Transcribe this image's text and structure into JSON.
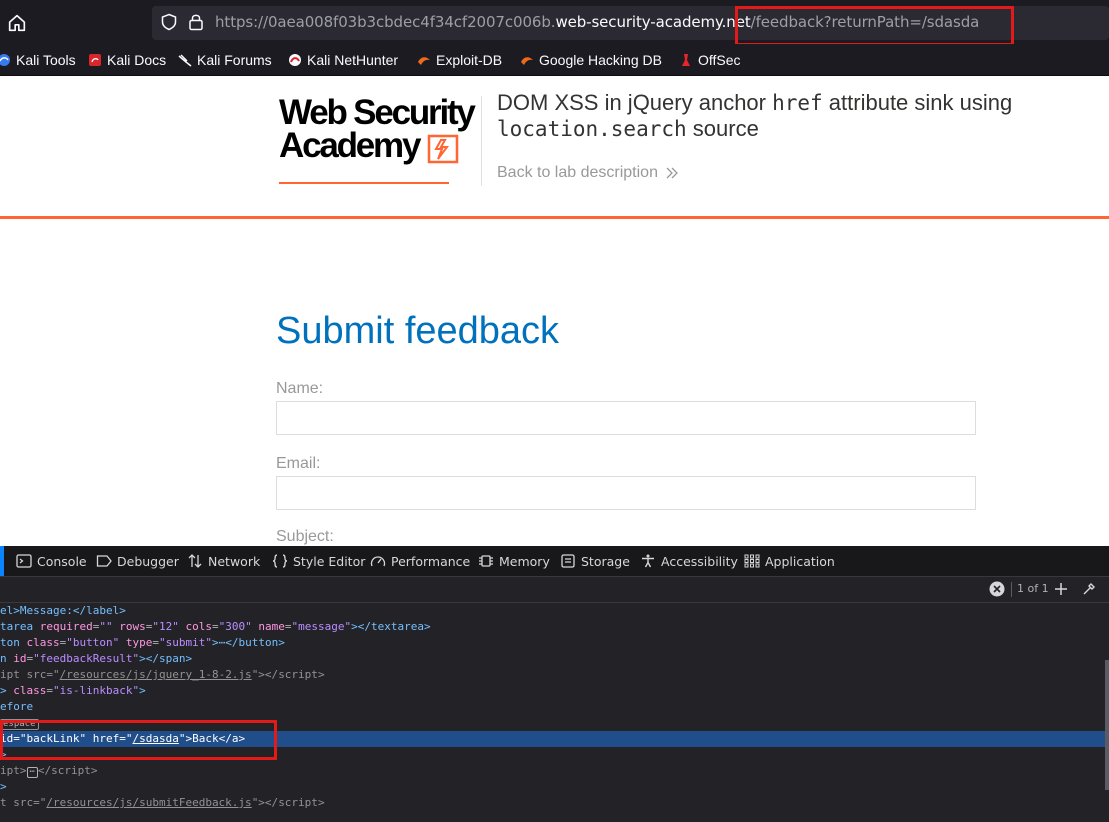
{
  "browser": {
    "url_prefix": "https://0aea008f03b3cbdec4f34cf2007c006b.",
    "url_host": "web-security-academy.net",
    "url_path": "/feedback?returnPath=/sdasda",
    "bookmarks": [
      "Kali Tools",
      "Kali Docs",
      "Kali Forums",
      "Kali NetHunter",
      "Exploit-DB",
      "Google Hacking DB",
      "OffSec"
    ]
  },
  "header": {
    "logo_line1": "Web Security",
    "logo_line2": "Academy",
    "lab_title_a": "DOM XSS in jQuery anchor ",
    "lab_title_code1": "href",
    "lab_title_b": " attribute sink using",
    "lab_title_code2": "location.search",
    "lab_title_c": " source",
    "back_link": "Back to lab description"
  },
  "form": {
    "title": "Submit feedback",
    "name_label": "Name:",
    "email_label": "Email:",
    "subject_label": "Subject:"
  },
  "devtools": {
    "tabs": [
      "Console",
      "Debugger",
      "Network",
      "Style Editor",
      "Performance",
      "Memory",
      "Storage",
      "Accessibility",
      "Application"
    ],
    "search_count": "1 of 1",
    "lines": {
      "l1_frag": "el",
      "l1_gt": ">Message:</",
      "l1_tag": "label",
      "l2_frag": "tarea",
      "l3_frag": "ton",
      "l3_tail": ">⋯</",
      "l3_close": "button",
      "l4_frag": "n",
      "l5_frag": "ipt",
      "l5_src": "/resources/js/jquery_1-8-2.js",
      "l6_class": "is-linkback",
      "l7_pseudo": "efore",
      "l8_pill": "espace",
      "l9_id": "backLink",
      "l9_href": "/sdasda",
      "l9_text": "Back",
      "l11_frag": "ipt",
      "l13_src": "/resources/js/submitFeedback.js"
    },
    "attrs": {
      "required": "required",
      "required_val": "\"\"",
      "rows": "rows",
      "rows_val": "\"12\"",
      "cols": "cols",
      "cols_val": "\"300\"",
      "name": "name",
      "name_val": "\"message\"",
      "textarea": "textarea",
      "class": "class",
      "class_val": "\"button\"",
      "type": "type",
      "type_val": "\"submit\"",
      "id": "id",
      "id_val": "\"feedbackResult\"",
      "span": "span",
      "src": "src",
      "script": "script",
      "href": "href",
      "a_tag": "a"
    }
  },
  "colors": {
    "accent_orange": "#ff6633",
    "title_blue": "#0071bc",
    "highlight_red": "#e31a1a",
    "selection_blue": "#204e8a"
  }
}
